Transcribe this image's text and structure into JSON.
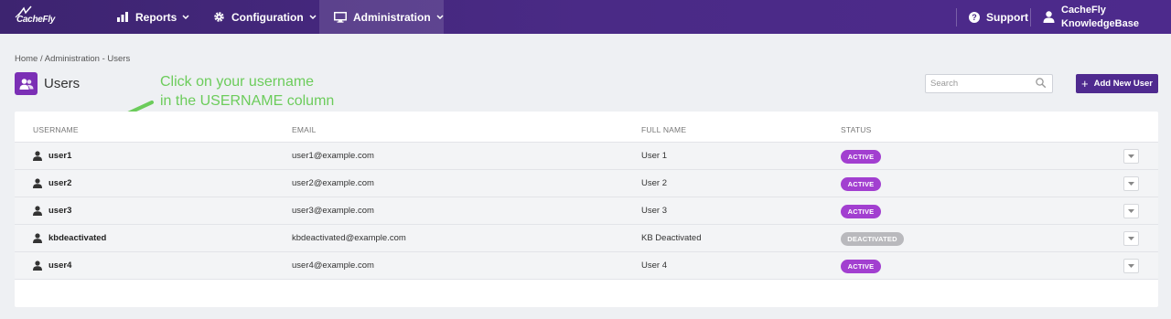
{
  "nav": {
    "logo_text": "CacheFly",
    "reports": "Reports",
    "configuration": "Configuration",
    "administration": "Administration",
    "support": "Support",
    "user_line1": "CacheFly",
    "user_line2": "KnowledgeBase"
  },
  "breadcrumb": {
    "home": "Home",
    "separator": "/",
    "current": "Administration - Users"
  },
  "page": {
    "title": "Users"
  },
  "annotation": {
    "line1": "Click on your username",
    "line2": "in the USERNAME column"
  },
  "search": {
    "placeholder": "Search",
    "value": ""
  },
  "add_button": {
    "plus": "+",
    "label": "Add New User"
  },
  "table": {
    "headers": {
      "username": "USERNAME",
      "email": "EMAIL",
      "full_name": "FULL NAME",
      "status": "STATUS"
    },
    "rows": [
      {
        "username": "user1",
        "email": "user1@example.com",
        "full_name": "User 1",
        "status": "ACTIVE"
      },
      {
        "username": "user2",
        "email": "user2@example.com",
        "full_name": "User 2",
        "status": "ACTIVE"
      },
      {
        "username": "user3",
        "email": "user3@example.com",
        "full_name": "User 3",
        "status": "ACTIVE"
      },
      {
        "username": "kbdeactivated",
        "email": "kbdeactivated@example.com",
        "full_name": "KB Deactivated",
        "status": "DEACTIVATED"
      },
      {
        "username": "user4",
        "email": "user4@example.com",
        "full_name": "User 4",
        "status": "ACTIVE"
      }
    ]
  },
  "colors": {
    "nav_bg": "#4a2a86",
    "accent": "#4f2a8f",
    "active_badge": "#a23fd0",
    "deactivated_badge": "#b9b9bd",
    "annotation": "#6ccc5b"
  },
  "icons": {
    "logo": "cachefly-logo",
    "reports": "bar-chart-icon",
    "configuration": "gear-icon",
    "administration": "monitor-icon",
    "support": "question-circle-icon",
    "user": "user-icon",
    "page": "users-icon",
    "search": "search-icon",
    "row_user": "user-icon",
    "row_menu": "caret-down-icon",
    "annotation_arrow": "arrow-icon"
  }
}
